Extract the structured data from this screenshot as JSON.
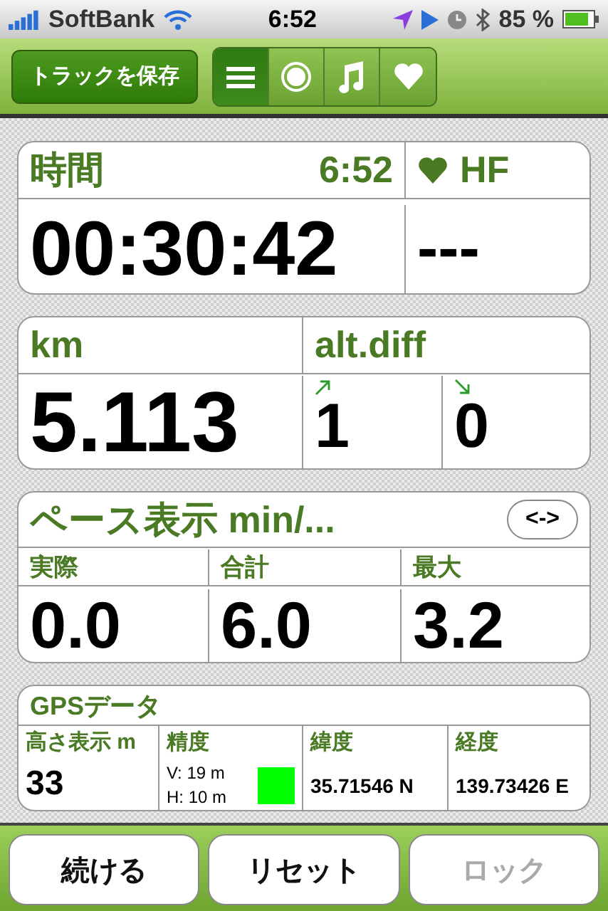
{
  "status_bar": {
    "carrier": "SoftBank",
    "time": "6:52",
    "battery": "85 %"
  },
  "toolbar": {
    "save_button": "トラックを保存",
    "segments": [
      {
        "kind": "list",
        "selected": true
      },
      {
        "kind": "record",
        "selected": false
      },
      {
        "kind": "music",
        "selected": false
      },
      {
        "kind": "heart",
        "selected": false
      }
    ]
  },
  "time_card": {
    "label": "時間",
    "clock": "6:52",
    "value": "00:30:42",
    "hf_label": "HF",
    "hf_value": "---"
  },
  "distance_card": {
    "label": "km",
    "value": "5.113",
    "alt_label": "alt.diff",
    "alt_up": "1",
    "alt_down": "0"
  },
  "pace_card": {
    "title": "ペース表示 min/...",
    "toggle": "<->",
    "columns": [
      {
        "label": "実際",
        "value": "0.0"
      },
      {
        "label": "合計",
        "value": "6.0"
      },
      {
        "label": "最大",
        "value": "3.2"
      }
    ]
  },
  "gps_card": {
    "title": "GPSデータ",
    "altitude_label": "高さ表示 m",
    "altitude": "33",
    "accuracy_label": "精度",
    "accuracy_v": "V: 19 m",
    "accuracy_h": "H: 10 m",
    "accuracy_good": true,
    "lat_label": "緯度",
    "lat": "35.71546 N",
    "lon_label": "経度",
    "lon": "139.73426 E"
  },
  "buttons": [
    {
      "label": "続ける",
      "disabled": false
    },
    {
      "label": "リセット",
      "disabled": false
    },
    {
      "label": "ロック",
      "disabled": true
    }
  ]
}
